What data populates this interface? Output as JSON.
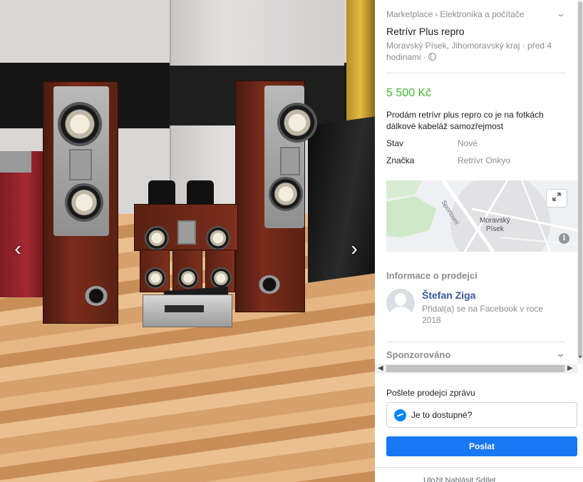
{
  "photo": {
    "prev_label": "‹",
    "next_label": "›"
  },
  "listing": {
    "breadcrumb": [
      "Marketplace",
      "Elektronika a počítače"
    ],
    "breadcrumb_sep": "›",
    "title": "Retrívr Plus repro",
    "location": "Moravský Písek, Jihomoravský kraj · před 4 hodinami ·",
    "price": "5 500 Kč",
    "description": "Prodám retrívr plus repro co je na fotkách dálkové kabeláž samozřejmost",
    "details": [
      {
        "key": "Stav",
        "value": "Nové"
      },
      {
        "key": "Značka",
        "value": "Retrívr Onkyo"
      }
    ],
    "map": {
      "street_label": "Sportovní",
      "town_line1": "Moravský",
      "town_line2": "Písek",
      "expand_icon": "expand-icon",
      "info_label": "i"
    }
  },
  "seller": {
    "heading": "Informace o prodejci",
    "name": "Štefan Ziga",
    "meta": "Přidal(a) se na Facebook v roce 2018"
  },
  "sponsored": {
    "label": "Sponzorováno"
  },
  "message": {
    "heading": "Pošlete prodejci zprávu",
    "input_value": "Je to dostupné?",
    "send_label": "Poslat"
  },
  "footer": {
    "actions": "Uložit   Nahlásit   Sdílet"
  },
  "colors": {
    "price": "#42b72a",
    "seller_name": "#385898",
    "send_button": "#1877f2",
    "messenger": "#0084ff"
  }
}
